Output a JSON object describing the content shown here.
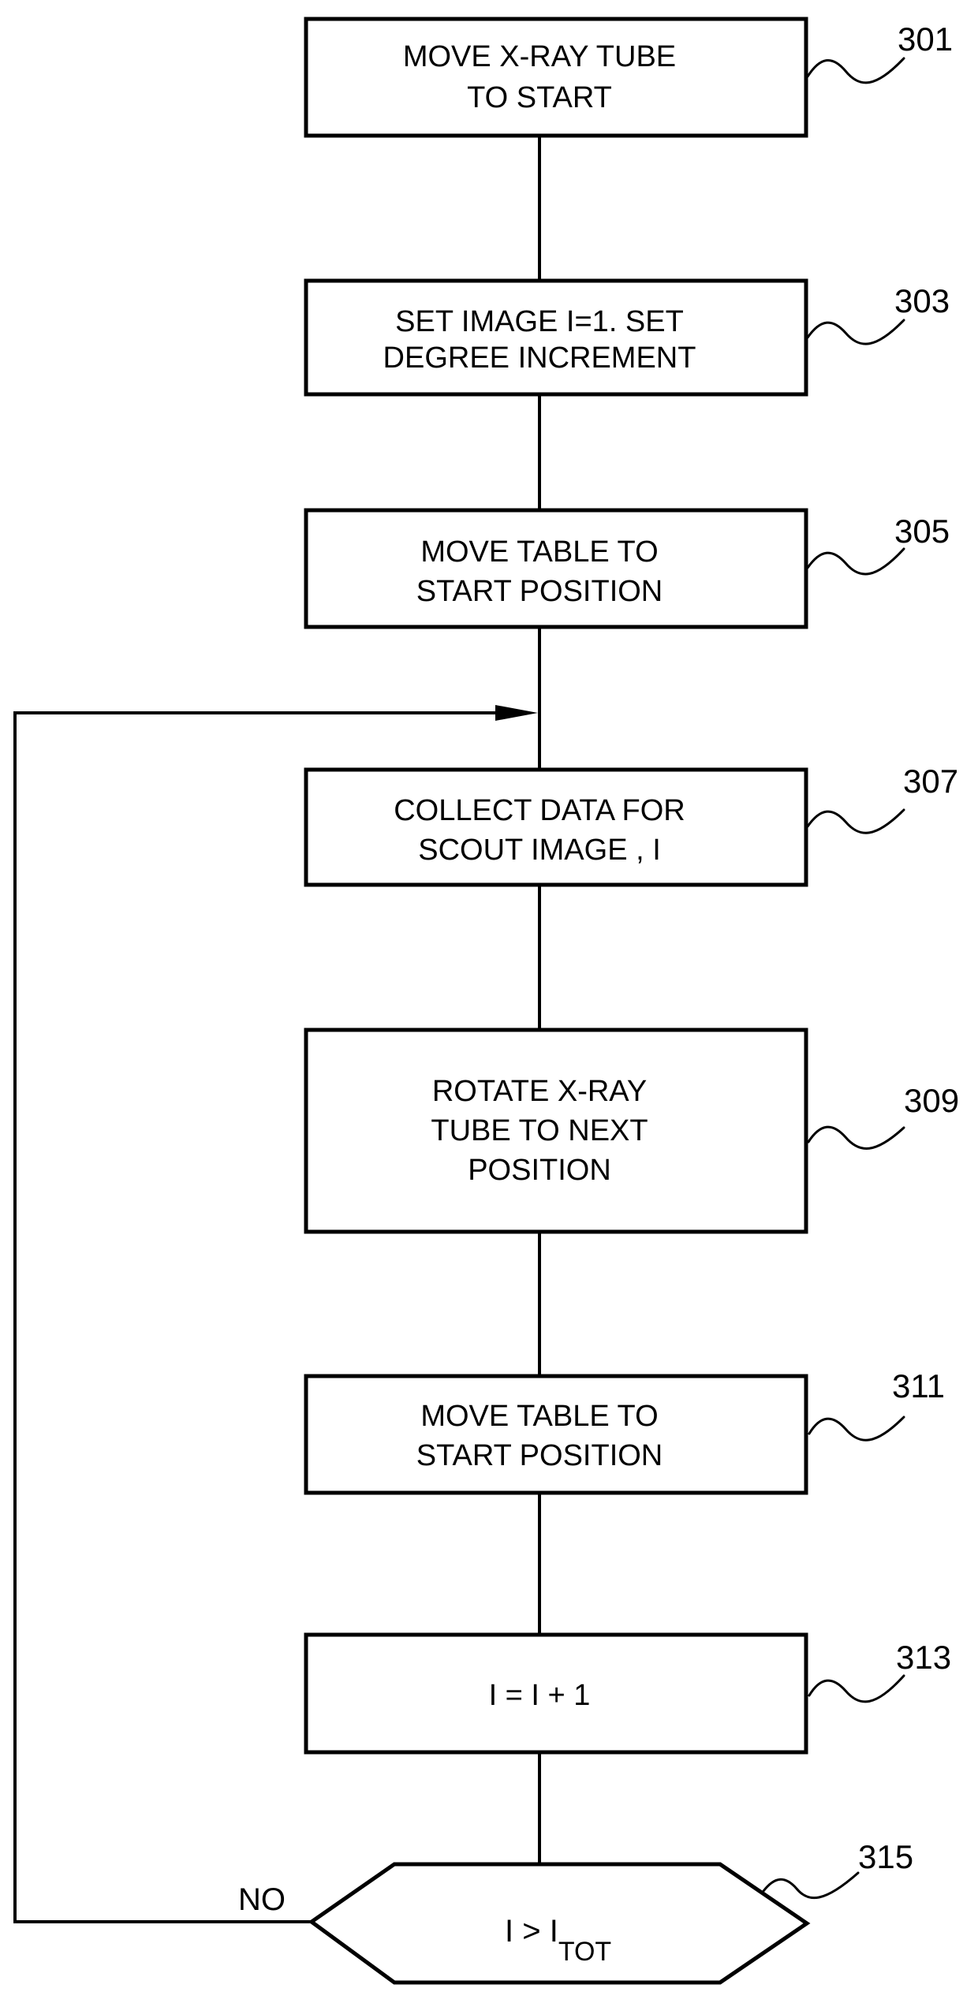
{
  "figure": {
    "type": "flowchart",
    "steps": [
      {
        "ref": "301",
        "lines": [
          "MOVE X-RAY TUBE",
          "TO START"
        ]
      },
      {
        "ref": "303",
        "lines": [
          "SET IMAGE I=1. SET",
          "DEGREE INCREMENT"
        ]
      },
      {
        "ref": "305",
        "lines": [
          "MOVE TABLE TO",
          "START POSITION"
        ]
      },
      {
        "ref": "307",
        "lines": [
          "COLLECT DATA FOR",
          "SCOUT IMAGE , I"
        ]
      },
      {
        "ref": "309",
        "lines": [
          "ROTATE X-RAY",
          "TUBE TO NEXT",
          "POSITION"
        ]
      },
      {
        "ref": "311",
        "lines": [
          "MOVE TABLE TO",
          "START POSITION"
        ]
      },
      {
        "ref": "313",
        "lines": [
          "I = I + 1"
        ]
      }
    ],
    "decision": {
      "ref": "315",
      "condition_main": "I > I",
      "condition_subscript": "TOT",
      "no_label": "NO"
    },
    "loop": {
      "from": "315",
      "branch": "NO",
      "to": "307",
      "arrow_icon": "arrowhead-right-icon"
    }
  }
}
